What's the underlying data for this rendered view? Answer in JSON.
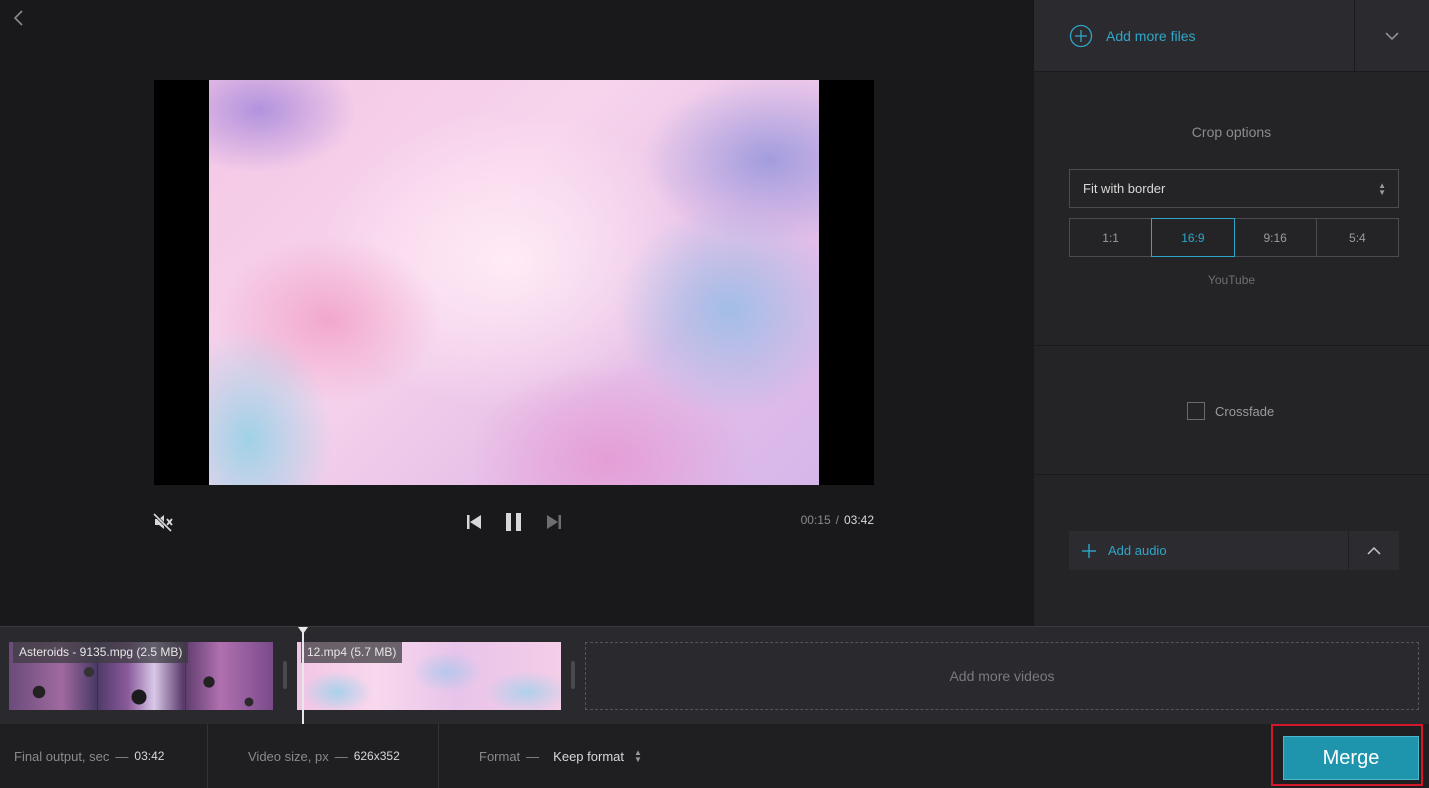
{
  "preview": {
    "current_time": "00:15",
    "time_separator": "/",
    "total_time": "03:42"
  },
  "panel": {
    "add_files_label": "Add more files",
    "crop": {
      "title": "Crop options",
      "mode": "Fit with border",
      "ratios": [
        "1:1",
        "16:9",
        "9:16",
        "5:4"
      ],
      "active_ratio": "16:9",
      "ratio_note": "YouTube"
    },
    "crossfade_label": "Crossfade",
    "crossfade_checked": false,
    "add_audio_label": "Add audio"
  },
  "timeline": {
    "clips": [
      {
        "label": "Asteroids - 9135.mpg (2.5 MB)"
      },
      {
        "label": "12.mp4 (5.7 MB)"
      }
    ],
    "add_videos_label": "Add more videos"
  },
  "bottombar": {
    "final_output_label": "Final output, sec",
    "final_output_value": "03:42",
    "video_size_label": "Video size, px",
    "video_size_value": "626x352",
    "format_label": "Format",
    "format_value": "Keep format",
    "dash": "—",
    "merge_label": "Merge"
  },
  "colors": {
    "accent": "#2fa6c9",
    "merge_button": "#1e95ad",
    "highlight_border": "#d4172a",
    "background": "#19191c",
    "panel": "#242427"
  },
  "icons": {
    "back": "chevron-left-icon",
    "mute": "speaker-muted-icon",
    "prev": "skip-previous-icon",
    "pause": "pause-icon",
    "next": "skip-next-icon",
    "add_files": "plus-circle-icon",
    "dropdown": "chevron-down-icon",
    "add_audio": "plus-icon",
    "collapse": "chevron-up-icon"
  }
}
